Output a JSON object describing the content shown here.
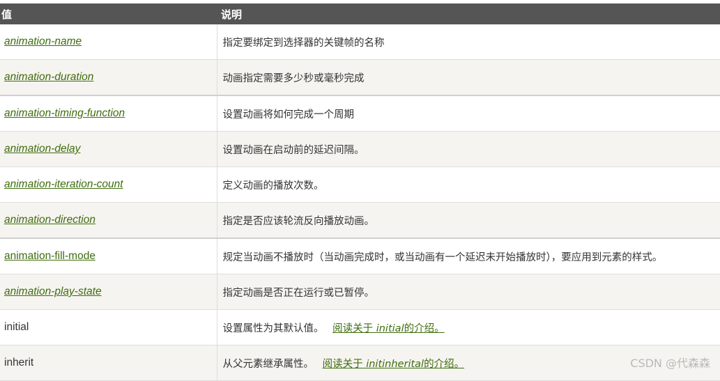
{
  "header": {
    "col_value": "值",
    "col_desc": "说明"
  },
  "rows": [
    {
      "value": "animation-name",
      "desc": "指定要绑定到选择器的关键帧的名称"
    },
    {
      "value": "animation-duration",
      "desc": "动画指定需要多少秒或毫秒完成"
    },
    {
      "value": "animation-timing-function",
      "desc": "设置动画将如何完成一个周期"
    },
    {
      "value": "animation-delay",
      "desc": "设置动画在启动前的延迟间隔。"
    },
    {
      "value": "animation-iteration-count",
      "desc": "定义动画的播放次数。"
    },
    {
      "value": "animation-direction",
      "desc": "指定是否应该轮流反向播放动画。"
    },
    {
      "value": "animation-fill-mode",
      "desc": "规定当动画不播放时（当动画完成时，或当动画有一个延迟未开始播放时），要应用到元素的样式。"
    },
    {
      "value": "animation-play-state",
      "desc": "指定动画是否正在运行或已暂停。"
    },
    {
      "value": "initial",
      "desc": "设置属性为其默认值。",
      "link_pre": "阅读关于",
      "link_em": "initial",
      "link_post": "的介绍。"
    },
    {
      "value": "inherit",
      "desc": "从父元素继承属性。",
      "link_pre": "阅读关于",
      "link_em": "initinherital",
      "link_post": "的介绍。"
    }
  ],
  "watermark": "CSDN @代森森"
}
